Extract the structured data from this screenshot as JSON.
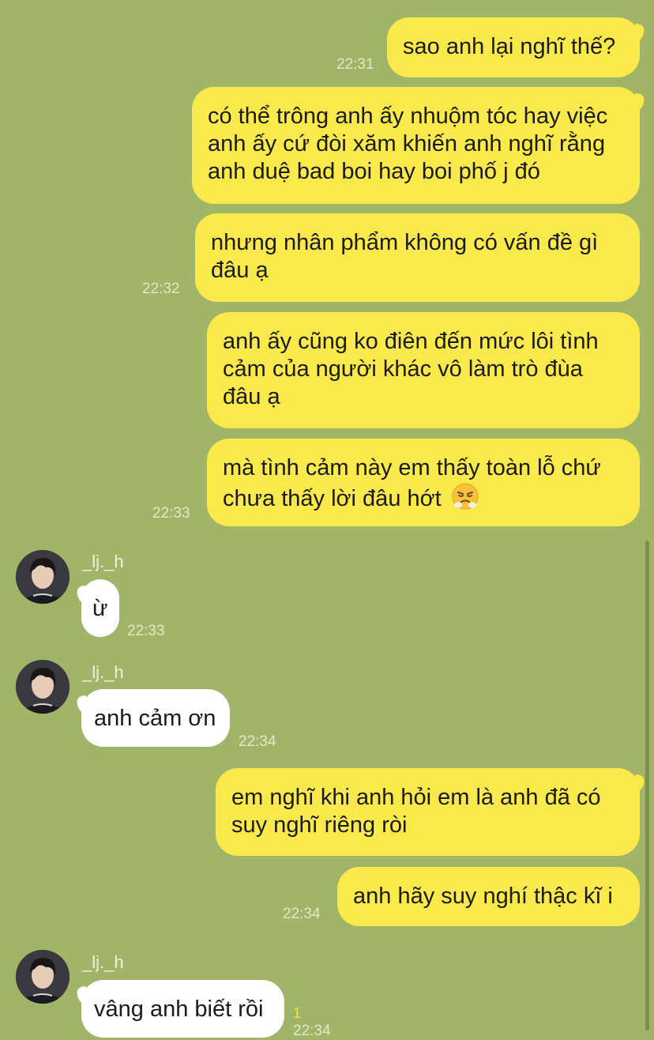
{
  "chat": {
    "messages": [
      {
        "direction": "out",
        "text": "sao anh lại nghĩ thế?",
        "time": "22:31"
      },
      {
        "direction": "out",
        "text": "có thể trông anh ấy nhuộm tóc hay việc anh ấy cứ đòi xăm khiến anh nghĩ rằng anh duệ bad boi hay boi phố j đó",
        "time": ""
      },
      {
        "direction": "out",
        "text": "nhưng nhân phẩm không có vấn đề gì đâu ạ",
        "time": "22:32"
      },
      {
        "direction": "out",
        "text": "anh ấy cũng ko điên đến mức lôi tình cảm của người khác vô làm trò đùa đâu ạ",
        "time": ""
      },
      {
        "direction": "out",
        "text": "mà tình cảm này em thấy toàn lỗ chứ chưa thấy lời đâu hớt",
        "emoji": "face-with-steam-from-nose",
        "time": "22:33"
      },
      {
        "direction": "in",
        "sender": "_lj._h",
        "text": "ừ",
        "time": "22:33"
      },
      {
        "direction": "in",
        "sender": "_lj._h",
        "text": "anh cảm ơn",
        "time": "22:34"
      },
      {
        "direction": "out",
        "text": "em nghĩ khi anh hỏi em là anh đã có suy nghĩ riêng ròi",
        "time": ""
      },
      {
        "direction": "out",
        "text": "anh hãy suy nghí thậc kĩ i",
        "time": "22:34"
      },
      {
        "direction": "in",
        "sender": "_lj._h",
        "text": "vâng anh biết rồi",
        "time": "22:34",
        "read_count": "1"
      }
    ]
  },
  "colors": {
    "background": "#a0b568",
    "sent_bubble": "#f9e94a",
    "received_bubble": "#ffffff",
    "timestamp": "#e2e9c8"
  }
}
